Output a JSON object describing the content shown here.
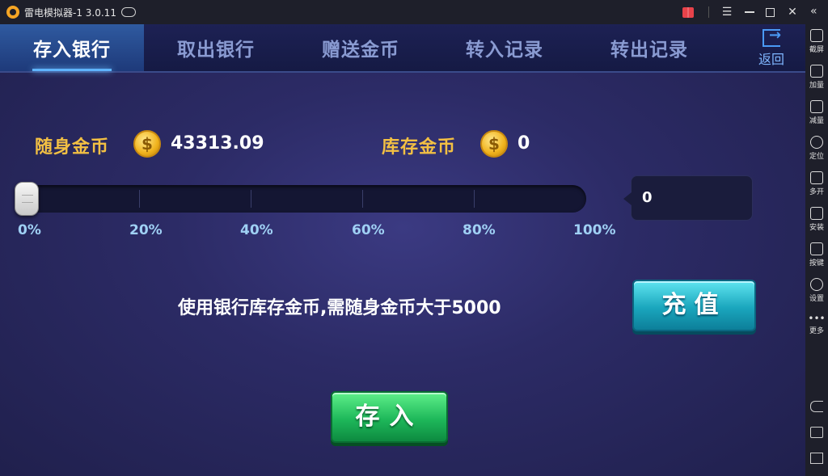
{
  "window": {
    "title": "雷电模拟器-1 3.0.11"
  },
  "sidebar": {
    "items": [
      {
        "label": "截屏",
        "icon": "scissors-icon"
      },
      {
        "label": "加量",
        "icon": "volume-up-icon"
      },
      {
        "label": "减量",
        "icon": "volume-down-icon"
      },
      {
        "label": "定位",
        "icon": "location-icon"
      },
      {
        "label": "多开",
        "icon": "multi-instance-icon"
      },
      {
        "label": "安装",
        "icon": "apk-install-icon"
      },
      {
        "label": "按键",
        "icon": "keyboard-icon"
      },
      {
        "label": "设置",
        "icon": "gear-icon"
      },
      {
        "label": "更多",
        "icon": "more-icon"
      }
    ]
  },
  "tabs": [
    {
      "label": "存入银行",
      "active": true
    },
    {
      "label": "取出银行",
      "active": false
    },
    {
      "label": "赠送金币",
      "active": false
    },
    {
      "label": "转入记录",
      "active": false
    },
    {
      "label": "转出记录",
      "active": false
    }
  ],
  "return_label": "返回",
  "carried_gold": {
    "label": "随身金币",
    "value": "43313.09"
  },
  "stored_gold": {
    "label": "库存金币",
    "value": "0"
  },
  "slider": {
    "value_percent": 0,
    "ticks": [
      "0%",
      "20%",
      "40%",
      "60%",
      "80%",
      "100%"
    ]
  },
  "amount_value": "0",
  "hint_text": "使用银行库存金币,需随身金币大于5000",
  "recharge_label": "充值",
  "deposit_label": "存入",
  "coin_symbol": "$",
  "colors": {
    "gold_label": "#f3c043",
    "tab_active": "#2f5aa0",
    "recharge": "#1aa6bd",
    "deposit": "#1eb85a"
  }
}
